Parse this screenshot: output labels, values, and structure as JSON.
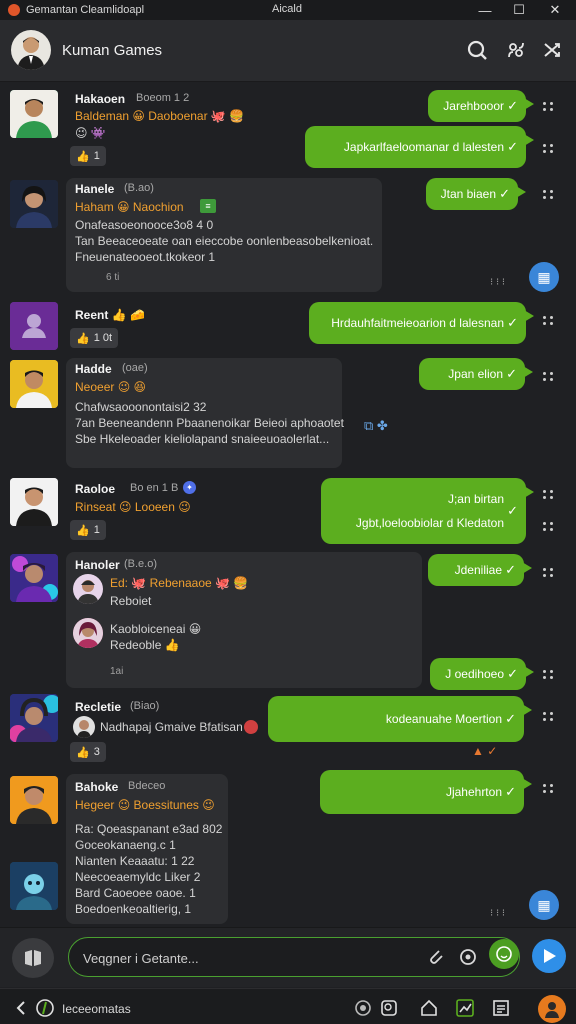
{
  "window": {
    "title_left": "Gemantan Cleamlidoapl",
    "title_center": "Aicald",
    "minimize_glyph": "—",
    "maximize_glyph": "☐",
    "close_glyph": "✕"
  },
  "header": {
    "title": "Kuman Games",
    "icons": [
      "search-icon",
      "group-icon",
      "shuffle-icon"
    ]
  },
  "messages": [
    {
      "name": "Hakaoen",
      "meta": "Boeom 1 2",
      "orange": "Baldeman 😀 Daoboenar 🐙 🍔",
      "extra": "😉 👾",
      "react_count": "1"
    },
    {
      "name": "Hanele",
      "meta": "(B.ao)",
      "orange": "Haham 😀 Naochion",
      "lines": [
        "Onafeasoeonooce3o8 4 0",
        "Tan Beeaceoeate oan eieccobe oonlenbeasobelkenioat.",
        "Fneuenateooeot.tkokeor 1"
      ],
      "small": "6 ti"
    },
    {
      "name": "Reent 👍 🧀",
      "react_count": "1 0t"
    },
    {
      "name": "Hadde",
      "meta": "(oae)",
      "orange": "Neoeer 😉 😆",
      "lines": [
        "Chafwsaooonontaisi2 32",
        "7an Beeneandenn Pbaanenoikar Beieoi aphoaotet",
        "Sbe Hkeleoader kieliolapand snaieeuoaolerlat..."
      ]
    },
    {
      "name": "Raoloe",
      "meta": "Bo en 1 B",
      "orange": "Rinseat 😉 Looeen 😉",
      "react_count": "1"
    },
    {
      "name": "Hanoler",
      "meta": "(B.e.o)",
      "orange": "Ed: 🐙 Rebenaaoe 🐙 🍔",
      "sub1": "Reboiet",
      "sub2_name": "Kaobloiceneai 😀",
      "sub2_text": "Redeoble 👍",
      "small": "1ai"
    },
    {
      "name": "Recletie",
      "meta": "(Biao)",
      "sub_text": "Nadhapaj Gmaive Bfatisan"
    },
    {
      "name": "Bahoke",
      "meta": "Bdeceo",
      "orange": "Hegeer 😉 Boessitunes 😉",
      "lines": [
        "Ra: Qoeaspanant e3ad 802",
        "Goceokanaeng.c 1",
        "Nianten Keaaatu: 1 22",
        "Neecoeaemyldc Liker 2",
        "Bard Caoeoee oaoe. 1",
        "Boedoenkeoaltierig, 1"
      ]
    }
  ],
  "outgoing": [
    {
      "text": "Jarehbooor"
    },
    {
      "text": "Japkarlfaeloomanar d lalesten"
    },
    {
      "text": "Jtan biaen"
    },
    {
      "text": "Hrdauhfaitmeieoarion d lalesnan"
    },
    {
      "text": "Jpan elion"
    },
    {
      "text": "J;an birtan"
    },
    {
      "text": "Jgbt,loeloobiolar d Kledaton"
    },
    {
      "text": "Jdeniliae"
    },
    {
      "text": "J oedihoeo"
    },
    {
      "text": "kodeanuahe Moertion"
    },
    {
      "text": "Jjahehrton"
    }
  ],
  "composer": {
    "placeholder": "Veqgner i Getante..."
  },
  "taskbar": {
    "label": "Ieceeomatas"
  }
}
